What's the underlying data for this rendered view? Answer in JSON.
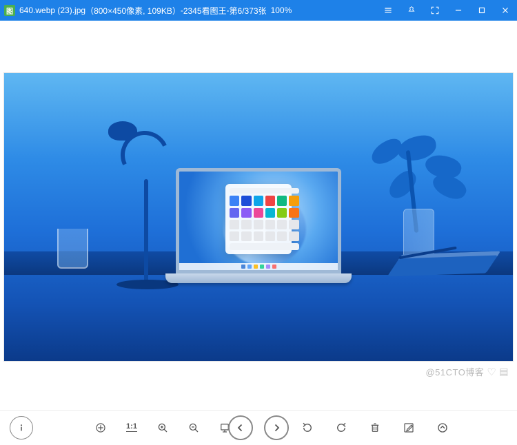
{
  "titlebar": {
    "filename": "640.webp (23).jpg",
    "dimensions": "（800×450像素, 109KB）",
    "app_sep": " - ",
    "app_name": "2345看图王",
    "page_sep": " - ",
    "page_info": "第6/373张",
    "zoom": "100%"
  },
  "toolbar": {
    "ratio_label": "1:1"
  },
  "watermark": {
    "text": "@51CTO博客"
  },
  "icons": {
    "menu": "menu-icon",
    "pin": "pin-icon",
    "fullscreen": "fullscreen-icon",
    "minimize": "minimize-icon",
    "maximize": "maximize-icon",
    "close": "close-icon"
  }
}
